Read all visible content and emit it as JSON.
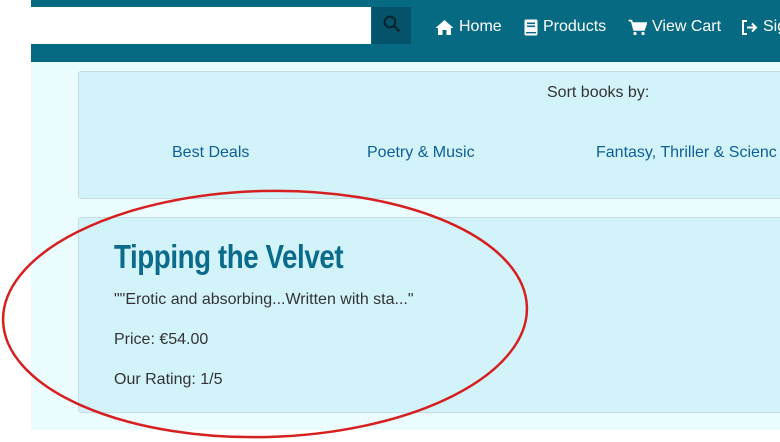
{
  "navbar": {
    "search": {
      "value": "",
      "placeholder": ""
    },
    "search_icon": "search-icon",
    "items": [
      {
        "label": "Home",
        "icon": "home-icon"
      },
      {
        "label": "Products",
        "icon": "book-icon"
      },
      {
        "label": "View Cart",
        "icon": "cart-icon"
      },
      {
        "label": "Sig",
        "icon": "sign-in-icon"
      }
    ]
  },
  "sort": {
    "title": "Sort books by:",
    "links": [
      "Best Deals",
      "Poetry & Music",
      "Fantasy, Thriller & Scienc"
    ]
  },
  "book": {
    "title": "Tipping the Velvet",
    "blurb": "\"\"Erotic and absorbing...Written with sta...\"",
    "price": "Price: €54.00",
    "rating": "Our Rating: 1/5"
  },
  "colors": {
    "navbar": "#066a83",
    "content_bg": "#ebfcfe",
    "panel_bg": "#d3f3fb",
    "title": "#0b6b8b",
    "link": "#0d5e9a",
    "annotation": "#d62020"
  }
}
